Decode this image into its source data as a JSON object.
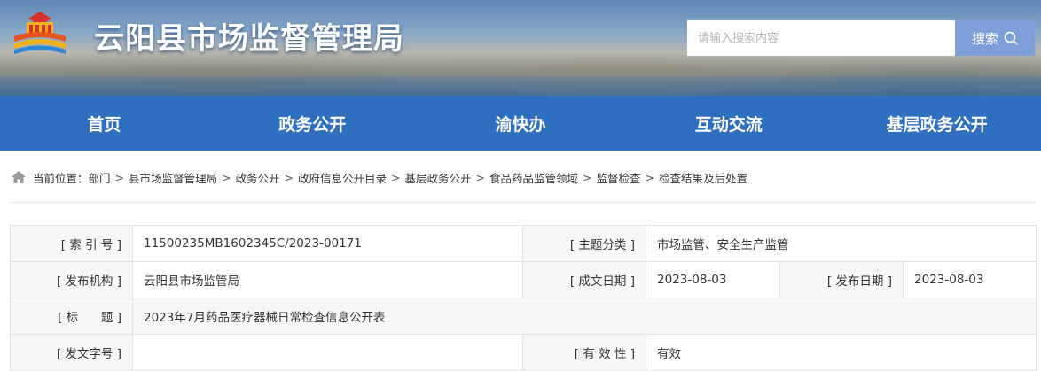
{
  "header": {
    "site_title": "云阳县市场监督管理局",
    "search_placeholder": "请输入搜索内容",
    "search_button": "搜索"
  },
  "nav": {
    "items": [
      "首页",
      "政务公开",
      "渝快办",
      "互动交流",
      "基层政务公开"
    ]
  },
  "breadcrumb": {
    "prefix": "当前位置：",
    "items": [
      "部门",
      "县市场监督管理局",
      "政务公开",
      "政府信息公开目录",
      "基层政务公开",
      "食品药品监管领域",
      "监督检查",
      "检查结果及后处置"
    ],
    "separator": ">"
  },
  "info": {
    "index_label": "[ 索 引 号 ]",
    "index_value": "11500235MB1602345C/2023-00171",
    "category_label": "[ 主题分类 ]",
    "category_value": "市场监管、安全生产监管",
    "publisher_label": "[ 发布机构 ]",
    "publisher_value": "云阳县市场监管局",
    "created_label": "[ 成文日期 ]",
    "created_value": "2023-08-03",
    "published_label": "[ 发布日期 ]",
    "published_value": "2023-08-03",
    "title_label": "[ 标      题 ]",
    "title_value": "2023年7月药品医疗器械日常检查信息公开表",
    "doc_no_label": "[ 发文字号 ]",
    "doc_no_value": "",
    "validity_label": "[ 有 效 性 ]",
    "validity_value": "有效"
  },
  "colors": {
    "nav_bg": "#2f6fc0",
    "search_button_bg": "#7e9fd9",
    "label_bg": "#f7f7f7"
  },
  "icons": [
    "emblem-logo",
    "search-icon",
    "home-icon"
  ]
}
